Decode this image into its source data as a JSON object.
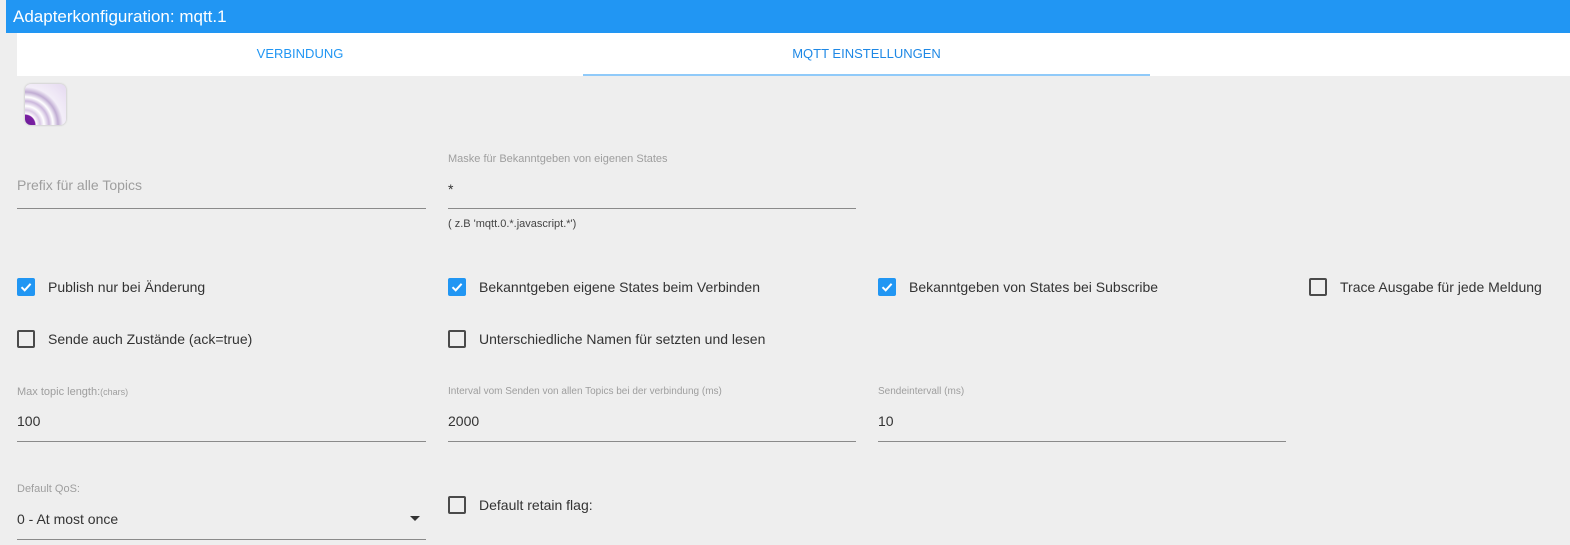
{
  "header": {
    "title": "Adapterkonfiguration: mqtt.1"
  },
  "tabs": [
    {
      "label": "VERBINDUNG",
      "active": false
    },
    {
      "label": "MQTT EINSTELLUNGEN",
      "active": true
    }
  ],
  "logo": {
    "icon": "mqtt-logo-icon"
  },
  "fields": {
    "prefix": {
      "placeholder": "Prefix für alle Topics",
      "value": ""
    },
    "mask": {
      "label": "Maske für Bekanntgeben von eigenen States",
      "value": "*",
      "help": "( z.B 'mqtt.0.*.javascript.*')"
    },
    "max_topic_length": {
      "label": "Max topic length:",
      "label_unit": "(chars)",
      "value": "100"
    },
    "interval_all_topics": {
      "label": "Interval vom Senden von allen Topics bei der verbindung (ms)",
      "value": "2000"
    },
    "send_interval": {
      "label": "Sendeintervall (ms)",
      "value": "10"
    },
    "default_qos": {
      "label": "Default QoS:",
      "value": "0 - At most once"
    }
  },
  "checkboxes": {
    "publish_on_change": {
      "label": "Publish nur bei Änderung",
      "checked": true
    },
    "publish_own_states_on_connect": {
      "label": "Bekanntgeben eigene States beim Verbinden",
      "checked": true
    },
    "publish_states_on_subscribe": {
      "label": "Bekanntgeben von States bei Subscribe",
      "checked": true
    },
    "trace_output": {
      "label": "Trace Ausgabe für jede Meldung",
      "checked": false
    },
    "send_ack_true": {
      "label": "Sende auch Zustände (ack=true)",
      "checked": false
    },
    "different_names": {
      "label": "Unterschiedliche Namen für setzten und lesen",
      "checked": false
    },
    "default_retain": {
      "label": "Default retain flag:",
      "checked": false
    }
  },
  "colors": {
    "accent": "#2196f3",
    "background": "#eeeeee",
    "tab_indicator": "#90caf9"
  }
}
